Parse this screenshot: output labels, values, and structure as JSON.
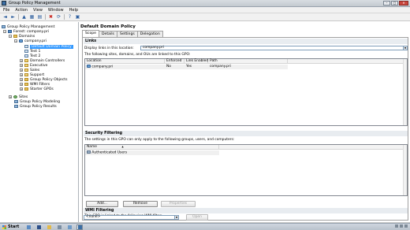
{
  "window": {
    "title": "Group Policy Management",
    "controls": [
      "–",
      "□",
      "✕"
    ]
  },
  "menubar": [
    "File",
    "Action",
    "View",
    "Window",
    "Help"
  ],
  "toolbar": {
    "buttons": [
      {
        "name": "back-icon",
        "glyph": "◄"
      },
      {
        "name": "forward-icon",
        "glyph": "►"
      },
      {
        "name": "up-folder-icon",
        "glyph": "▲"
      },
      {
        "name": "show-hide-tree-icon",
        "glyph": "▦"
      },
      {
        "name": "properties-icon",
        "glyph": "▤"
      },
      {
        "name": "delete-icon",
        "glyph": "✖"
      },
      {
        "name": "refresh-icon",
        "glyph": "⟳"
      },
      {
        "name": "help-icon",
        "glyph": "?"
      },
      {
        "name": "console-icon",
        "glyph": "▣"
      }
    ]
  },
  "tree": {
    "nodes": [
      {
        "label": "Group Policy Management",
        "expander": "",
        "icon": "model"
      },
      {
        "label": "Forest: company.pri",
        "expander": "−",
        "icon": "forest"
      },
      {
        "label": "Domains",
        "expander": "−",
        "icon": "folder"
      },
      {
        "label": "company.pri",
        "expander": "−",
        "icon": "domain"
      },
      {
        "label": "Default Domain Policy",
        "expander": "",
        "icon": "gpo",
        "selected": true
      },
      {
        "label": "Test 1",
        "expander": "",
        "icon": "gpo"
      },
      {
        "label": "Test 2",
        "expander": "",
        "icon": "gpo"
      },
      {
        "label": "Domain Controllers",
        "expander": "+",
        "icon": "ou"
      },
      {
        "label": "Executive",
        "expander": "+",
        "icon": "ou"
      },
      {
        "label": "Sales",
        "expander": "+",
        "icon": "ou"
      },
      {
        "label": "Support",
        "expander": "+",
        "icon": "ou"
      },
      {
        "label": "Group Policy Objects",
        "expander": "+",
        "icon": "folder"
      },
      {
        "label": "WMI Filters",
        "expander": "+",
        "icon": "folder"
      },
      {
        "label": "Starter GPOs",
        "expander": "+",
        "icon": "folder"
      },
      {
        "label": "Sites",
        "expander": "+",
        "icon": "sites"
      },
      {
        "label": "Group Policy Modeling",
        "expander": "",
        "icon": "model"
      },
      {
        "label": "Group Policy Results",
        "expander": "",
        "icon": "model"
      }
    ]
  },
  "detail": {
    "title": "Default Domain Policy",
    "tabs": [
      "Scope",
      "Details",
      "Settings",
      "Delegation"
    ],
    "active_tab": "Scope",
    "links": {
      "heading": "Links",
      "display_label": "Display links in this location:",
      "location_value": "company.pri",
      "description": "The following sites, domains, and OUs are linked to this GPO:",
      "columns": [
        "Location",
        "Enforced",
        "Link Enabled",
        "Path"
      ],
      "rows": [
        {
          "location": "company.pri",
          "enforced": "No",
          "link_enabled": "Yes",
          "path": "company.pri"
        }
      ]
    },
    "security": {
      "heading": "Security Filtering",
      "description": "The settings in this GPO can only apply to the following groups, users, and computers:",
      "column": "Name",
      "sort_glyph": "▲",
      "rows": [
        "Authenticated Users"
      ],
      "buttons": {
        "add": "Add...",
        "remove": "Remove",
        "properties": "Properties"
      }
    },
    "wmi": {
      "heading": "WMI Filtering",
      "description": "This GPO is linked to the following WMI filter:",
      "filter_value": "<none>",
      "open_label": "Open"
    }
  },
  "taskbar": {
    "start_label": "Start",
    "tray_time": ""
  },
  "colors": {
    "selection": "#3399ff",
    "section_header": "#e8ecf0",
    "link_row": "#f0f0f0"
  }
}
